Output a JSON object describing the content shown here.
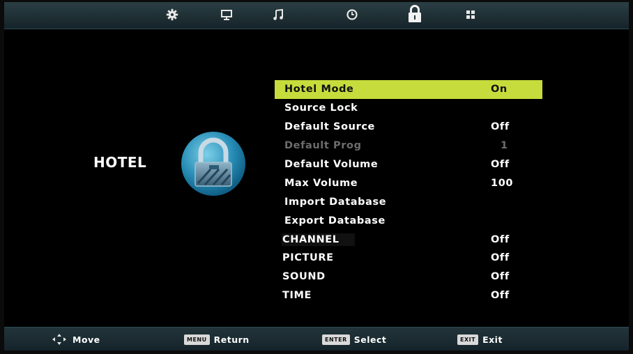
{
  "tabs": [
    {
      "icon": "gear-icon",
      "label": "Setup"
    },
    {
      "icon": "monitor-icon",
      "label": "Picture"
    },
    {
      "icon": "music-note-icon",
      "label": "Sound"
    },
    {
      "icon": "clock-icon",
      "label": "Time"
    },
    {
      "icon": "lock-icon",
      "label": "Lock",
      "active": true
    },
    {
      "icon": "grid-icon",
      "label": "Other"
    }
  ],
  "panel": {
    "title": "HOTEL",
    "icon": "padlock-badge-icon"
  },
  "menu": {
    "items": [
      {
        "label": "Hotel Mode",
        "value": "On",
        "state": "selected"
      },
      {
        "label": "Source Lock",
        "value": ""
      },
      {
        "label": "Default Source",
        "value": "Off"
      },
      {
        "label": "Default Prog",
        "value": "1",
        "state": "disabled"
      },
      {
        "label": "Default Volume",
        "value": "Off"
      },
      {
        "label": "Max Volume",
        "value": "100"
      },
      {
        "label": "Import Database",
        "value": ""
      },
      {
        "label": "Export Database",
        "value": ""
      },
      {
        "label": "CHANNEL",
        "value": "Off",
        "state": "section"
      },
      {
        "label": "PICTURE",
        "value": "Off",
        "state": "section"
      },
      {
        "label": "SOUND",
        "value": "Off",
        "state": "section"
      },
      {
        "label": "TIME",
        "value": "Off",
        "state": "section"
      }
    ]
  },
  "footer": {
    "move_label": "Move",
    "menu_key": "MENU",
    "return_label": "Return",
    "enter_key": "ENTER",
    "select_label": "Select",
    "exit_key": "EXIT",
    "exit_label": "Exit"
  },
  "colors": {
    "highlight": "#c6dc3c",
    "background": "#000000",
    "bar": "#1f3035",
    "disabled_text": "#6c6c6c"
  }
}
